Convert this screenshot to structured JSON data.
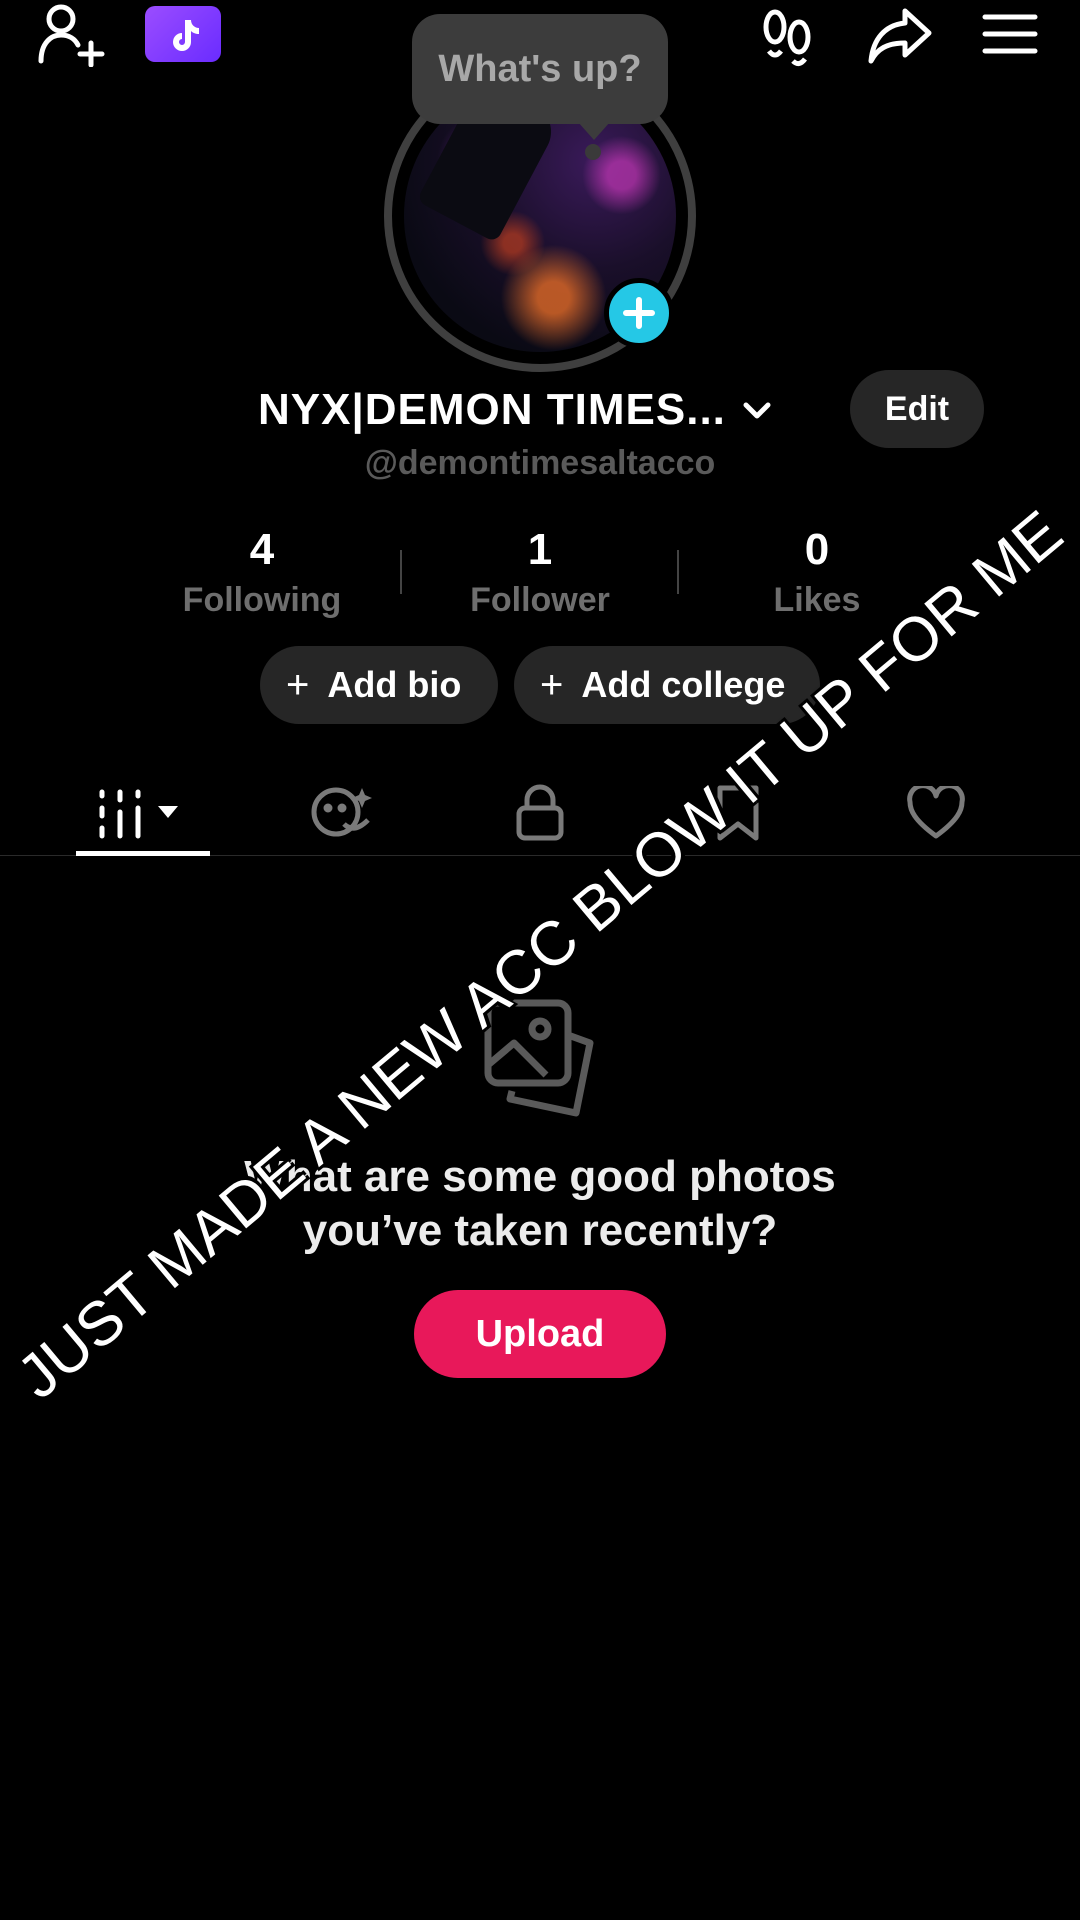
{
  "header": {
    "bubble_text": "What's up?"
  },
  "profile": {
    "display_name": "NYX|DEMON TIMES...",
    "handle": "@demontimesaltacco",
    "edit_label": "Edit"
  },
  "stats": [
    {
      "value": "4",
      "label": "Following"
    },
    {
      "value": "1",
      "label": "Follower"
    },
    {
      "value": "0",
      "label": "Likes"
    }
  ],
  "actions": {
    "add_bio": "Add bio",
    "add_college": "Add college",
    "plus": "+"
  },
  "tabs": [
    {
      "icon": "grid-icon",
      "active": true
    },
    {
      "icon": "repost-smiley-icon"
    },
    {
      "icon": "lock-icon"
    },
    {
      "icon": "bookmark-icon"
    },
    {
      "icon": "heart-icon"
    }
  ],
  "empty_state": {
    "title_line1": "What are some good photos",
    "title_line2": "you’ve taken recently?",
    "upload_label": "Upload"
  },
  "overlay_text": "JUST MADE A NEW ACC BLOW IT UP FOR ME",
  "colors": {
    "accent": "#e8185a",
    "plus_badge": "#25c8e6",
    "promo": "#7a34ff"
  }
}
